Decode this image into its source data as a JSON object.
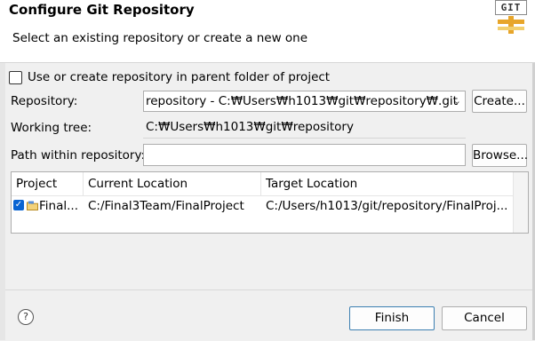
{
  "header": {
    "title": "Configure Git Repository",
    "subtitle": "Select an existing repository or create a new one",
    "logo_text": "GIT"
  },
  "options": {
    "use_parent_label": "Use or create repository in parent folder of project",
    "use_parent_checked": false
  },
  "repository": {
    "label": "Repository:",
    "value": "repository - C:₩Users₩h1013₩git₩repository₩.git",
    "create_button": "Create..."
  },
  "working_tree": {
    "label": "Working tree:",
    "value": "C:₩Users₩h1013₩git₩repository"
  },
  "path_within": {
    "label": "Path within repository:",
    "value": "",
    "browse_button": "Browse..."
  },
  "table": {
    "columns": [
      "Project",
      "Current Location",
      "Target Location"
    ],
    "rows": [
      {
        "checked": true,
        "project": "Final...",
        "current": "C:/Final3Team/FinalProject",
        "target": "C:/Users/h1013/git/repository/FinalProj..."
      }
    ]
  },
  "footer": {
    "help_icon": "?",
    "finish_button": "Finish",
    "cancel_button": "Cancel"
  },
  "colors": {
    "accent": "#0a64d2",
    "dialog_bg": "#f0f0f0",
    "header_bg": "#ffffff"
  }
}
